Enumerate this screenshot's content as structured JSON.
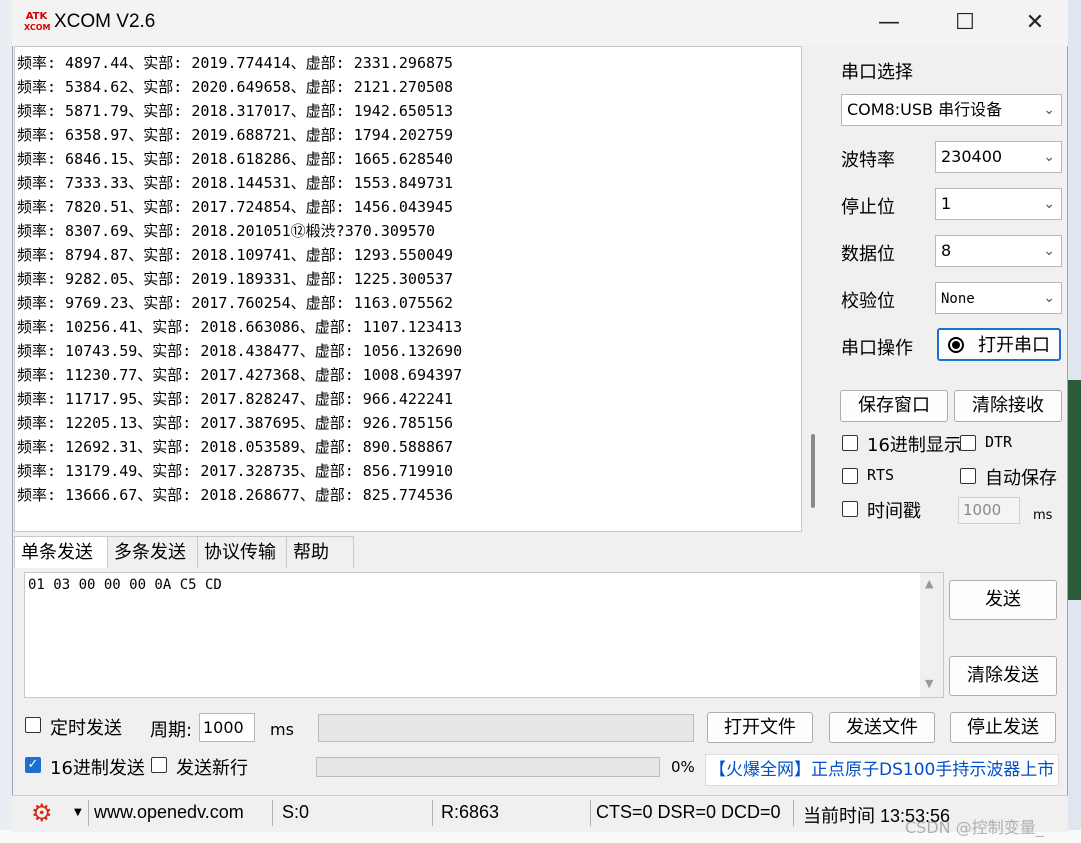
{
  "window": {
    "title": "XCOM V2.6",
    "logo_text_top": "ATK",
    "logo_text_bottom": "XCOM",
    "minimize_glyph": "—",
    "maximize_glyph": "☐",
    "close_glyph": "✕"
  },
  "receive_lines": [
    "频率: 4897.44、实部: 2019.774414、虚部: 2331.296875",
    "频率: 5384.62、实部: 2020.649658、虚部: 2121.270508",
    "频率: 5871.79、实部: 2018.317017、虚部: 1942.650513",
    "频率: 6358.97、实部: 2019.688721、虚部: 1794.202759",
    "频率: 6846.15、实部: 2018.618286、虚部: 1665.628540",
    "频率: 7333.33、实部: 2018.144531、虚部: 1553.849731",
    "频率: 7820.51、实部: 2017.724854、虚部: 1456.043945",
    "频率: 8307.69、实部: 2018.201051⑫椴渋?370.309570",
    "频率: 8794.87、实部: 2018.109741、虚部: 1293.550049",
    "频率: 9282.05、实部: 2019.189331、虚部: 1225.300537",
    "频率: 9769.23、实部: 2017.760254、虚部: 1163.075562",
    "频率: 10256.41、实部: 2018.663086、虚部: 1107.123413",
    "频率: 10743.59、实部: 2018.438477、虚部: 1056.132690",
    "频率: 11230.77、实部: 2017.427368、虚部: 1008.694397",
    "频率: 11717.95、实部: 2017.828247、虚部: 966.422241",
    "频率: 12205.13、实部: 2017.387695、虚部: 926.785156",
    "频率: 12692.31、实部: 2018.053589、虚部: 890.588867",
    "频率: 13179.49、实部: 2017.328735、虚部: 856.719910",
    "频率: 13666.67、实部: 2018.268677、虚部: 825.774536"
  ],
  "panel": {
    "port_select_label": "串口选择",
    "port_value": "COM8:USB 串行设备",
    "baud_label": "波特率",
    "baud_value": "230400",
    "stopbits_label": "停止位",
    "stopbits_value": "1",
    "databits_label": "数据位",
    "databits_value": "8",
    "parity_label": "校验位",
    "parity_value": "None",
    "port_op_label": "串口操作",
    "open_port_button": "打开串口",
    "save_window_button": "保存窗口",
    "clear_receive_button": "清除接收",
    "hex_display_label": "16进制显示",
    "dtr_label": "DTR",
    "rts_label": "RTS",
    "auto_save_label": "自动保存",
    "timestamp_label": "时间戳",
    "timestamp_ms_value": "1000",
    "timestamp_unit": "ms"
  },
  "tabs": [
    "单条发送",
    "多条发送",
    "协议传输",
    "帮助"
  ],
  "send": {
    "tx_text": "01 03 00 00 00 0A C5 CD",
    "send_button": "发送",
    "clear_send_button": "清除发送",
    "timed_send_label": "定时发送",
    "period_label": "周期:",
    "period_value": "1000",
    "period_unit": "ms",
    "open_file_button": "打开文件",
    "send_file_button": "发送文件",
    "stop_send_button": "停止发送",
    "hex_send_label": "16进制发送",
    "hex_send_checked": true,
    "send_newline_label": "发送新行",
    "progress_text": "0%",
    "progress_value": 0,
    "ad_text": "【火爆全网】正点原子DS100手持示波器上市"
  },
  "status": {
    "website": "www.openedv.com",
    "sent": "S:0",
    "received": "R:6863",
    "lines": "CTS=0 DSR=0 DCD=0",
    "time": "当前时间 13:53:56"
  },
  "watermark": "CSDN @控制变量_",
  "colors": {
    "accent": "#1f6fd1",
    "ad_blue": "#0050c8",
    "gear_red": "#d42a1a"
  }
}
